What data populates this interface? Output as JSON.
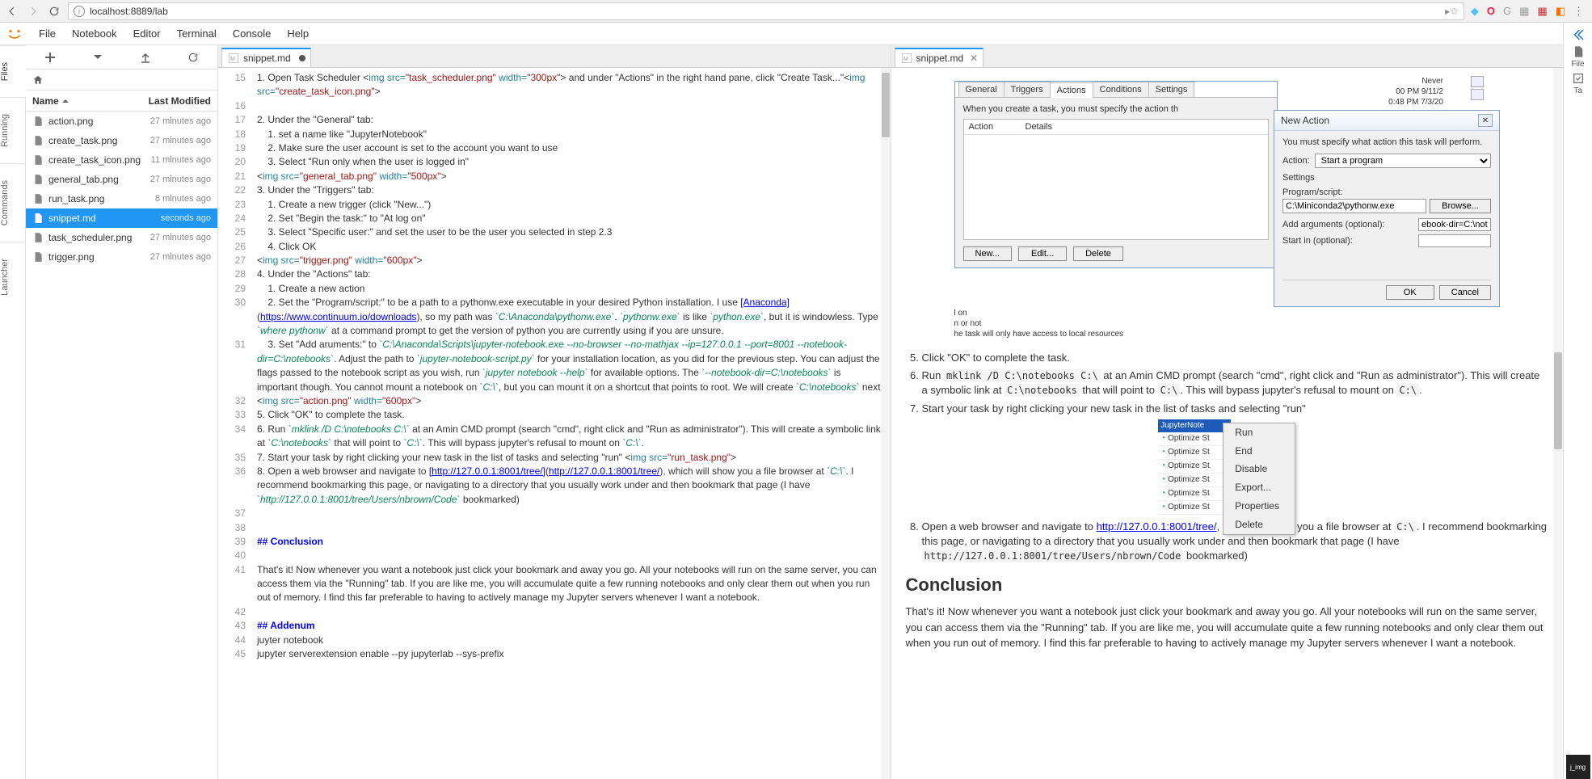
{
  "browser": {
    "url": "localhost:8889/lab"
  },
  "menu": {
    "items": [
      "File",
      "Notebook",
      "Editor",
      "Terminal",
      "Console",
      "Help"
    ]
  },
  "left_tabs": [
    "Files",
    "Running",
    "Commands",
    "Launcher"
  ],
  "right_tabs": [
    "File",
    "Ta"
  ],
  "filebrowser": {
    "header_name": "Name",
    "header_modified": "Last Modified",
    "rows": [
      {
        "name": "action.png",
        "time": "27 minutes ago",
        "sel": false
      },
      {
        "name": "create_task.png",
        "time": "27 minutes ago",
        "sel": false
      },
      {
        "name": "create_task_icon.png",
        "time": "11 minutes ago",
        "sel": false
      },
      {
        "name": "general_tab.png",
        "time": "27 minutes ago",
        "sel": false
      },
      {
        "name": "run_task.png",
        "time": "8 minutes ago",
        "sel": false
      },
      {
        "name": "snippet.md",
        "time": "seconds ago",
        "sel": true
      },
      {
        "name": "task_scheduler.png",
        "time": "27 minutes ago",
        "sel": false
      },
      {
        "name": "trigger.png",
        "time": "27 minutes ago",
        "sel": false
      }
    ]
  },
  "editor_tab": {
    "label": "snippet.md"
  },
  "preview_tab": {
    "label": "snippet.md"
  },
  "preview": {
    "li5": "Click \"OK\" to complete the task.",
    "li6_a": "Run ",
    "li6_code": "mklink /D C:\\notebooks C:\\",
    "li6_b": " at an Amin CMD prompt (search \"cmd\", right click and \"Run as administrator\"). This will create a symbolic link at ",
    "li6_code2": "C:\\notebooks",
    "li6_c": " that will point to ",
    "li6_code3": "C:\\",
    "li6_d": ". This will bypass jupyter's refusal to mount on ",
    "li6_code4": "C:\\",
    "li6_e": ".",
    "li7": "Start your task by right clicking your new task in the list of tasks and selecting \"run\"",
    "li8_a": "Open a web browser and navigate to ",
    "li8_link": "http://127.0.0.1:8001/tree/",
    "li8_b": ", which will show you a file browser at ",
    "li8_code": "C:\\",
    "li8_c": ". I recommend bookmarking this page, or navigating to a directory that you usually work under and then bookmark that page (I have ",
    "li8_code2": "http://127.0.0.1:8001/tree/Users/nbrown/Code",
    "li8_d": " bookmarked)",
    "conclusion_h": "Conclusion",
    "conclusion_p": "That's it! Now whenever you want a notebook just click your bookmark and away you go. All your notebooks will run on the same server, you can access them via the \"Running\" tab. If you are like me, you will accumulate quite a few running notebooks and only clear them out when you run out of memory. I find this far preferable to having to actively manage my Jupyter servers whenever I want a notebook."
  },
  "new_action_dialog": {
    "title": "New Action",
    "mustspecify": "You must specify what action this task will perform.",
    "action_lbl": "Action:",
    "action_val": "Start a program",
    "settings": "Settings",
    "program_lbl": "Program/script:",
    "program_val": "C:\\Miniconda2\\pythonw.exe",
    "browse": "Browse...",
    "args_lbl": "Add arguments (optional):",
    "args_val": "ebook-dir=C:\\notebooks",
    "start_lbl": "Start in (optional):",
    "ok": "OK",
    "cancel": "Cancel"
  },
  "actions_panel": {
    "tabs": [
      "General",
      "Triggers",
      "Actions",
      "Conditions",
      "Settings"
    ],
    "hint": "When you create a task, you must specify the action th",
    "col_action": "Action",
    "col_details": "Details",
    "btn_new": "New...",
    "btn_edit": "Edit...",
    "btn_delete": "Delete",
    "never": "Never",
    "t1": "00 PM  9/11/2",
    "t2": "0:48 PM  7/3/20",
    "f1": "l on",
    "f2": "n or not",
    "f3": "he task will only have access to local resources"
  },
  "ctx": {
    "sel": "JupyterNote",
    "items_below": [
      "Optimize St",
      "Optimize St",
      "Optimize St",
      "Optimize St",
      "Optimize St",
      "Optimize St"
    ],
    "menu": [
      "Run",
      "End",
      "Disable",
      "Export...",
      "Properties",
      "Delete"
    ]
  },
  "right_thumb": "j_img"
}
